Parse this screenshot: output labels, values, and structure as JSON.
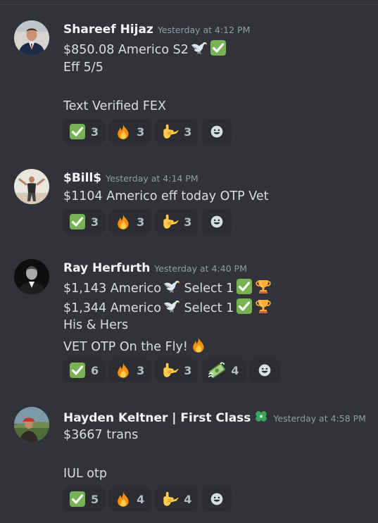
{
  "messages": [
    {
      "username": "Shareef Hijaz",
      "timestamp": "Yesterday at 4:12 PM",
      "lines": [
        "$850.08 Americo S2",
        "Eff 5/5",
        "",
        "Text Verified FEX"
      ],
      "reactions": [
        {
          "emoji": "check-mark-emoji",
          "count": "3"
        },
        {
          "emoji": "fire-emoji",
          "count": "3"
        },
        {
          "emoji": "call-me-hand-emoji",
          "count": "3"
        }
      ]
    },
    {
      "username": "$Bill$",
      "timestamp": "Yesterday at 4:14 PM",
      "lines": [
        "$1104 Americo eff today OTP Vet"
      ],
      "reactions": [
        {
          "emoji": "check-mark-emoji",
          "count": "3"
        },
        {
          "emoji": "fire-emoji",
          "count": "3"
        },
        {
          "emoji": "call-me-hand-emoji",
          "count": "3"
        }
      ]
    },
    {
      "username": "Ray Herfurth",
      "timestamp": "Yesterday at 4:40 PM",
      "lines": [
        "$1,143 Americo",
        "Select 1",
        "$1,344 Americo",
        "Select 1",
        "His & Hers",
        "VET OTP On the Fly!"
      ],
      "reactions": [
        {
          "emoji": "check-mark-emoji",
          "count": "6"
        },
        {
          "emoji": "fire-emoji",
          "count": "3"
        },
        {
          "emoji": "call-me-hand-emoji",
          "count": "3"
        },
        {
          "emoji": "money-with-wings-emoji",
          "count": "4"
        }
      ]
    },
    {
      "username": "Hayden Keltner | First Class",
      "timestamp": "Yesterday at 4:58 PM",
      "lines": [
        "$3667 trans",
        "",
        "IUL otp"
      ],
      "reactions": [
        {
          "emoji": "check-mark-emoji",
          "count": "5"
        },
        {
          "emoji": "fire-emoji",
          "count": "4"
        },
        {
          "emoji": "call-me-hand-emoji",
          "count": "4"
        }
      ]
    }
  ],
  "colors": {
    "background": "#313338",
    "username": "#f2f3f5",
    "timestamp": "#949ba4",
    "text": "#dbdee1",
    "reaction_bg": "#2b2d31",
    "check_green": "#77b255",
    "badge_green": "#3ba55c"
  }
}
